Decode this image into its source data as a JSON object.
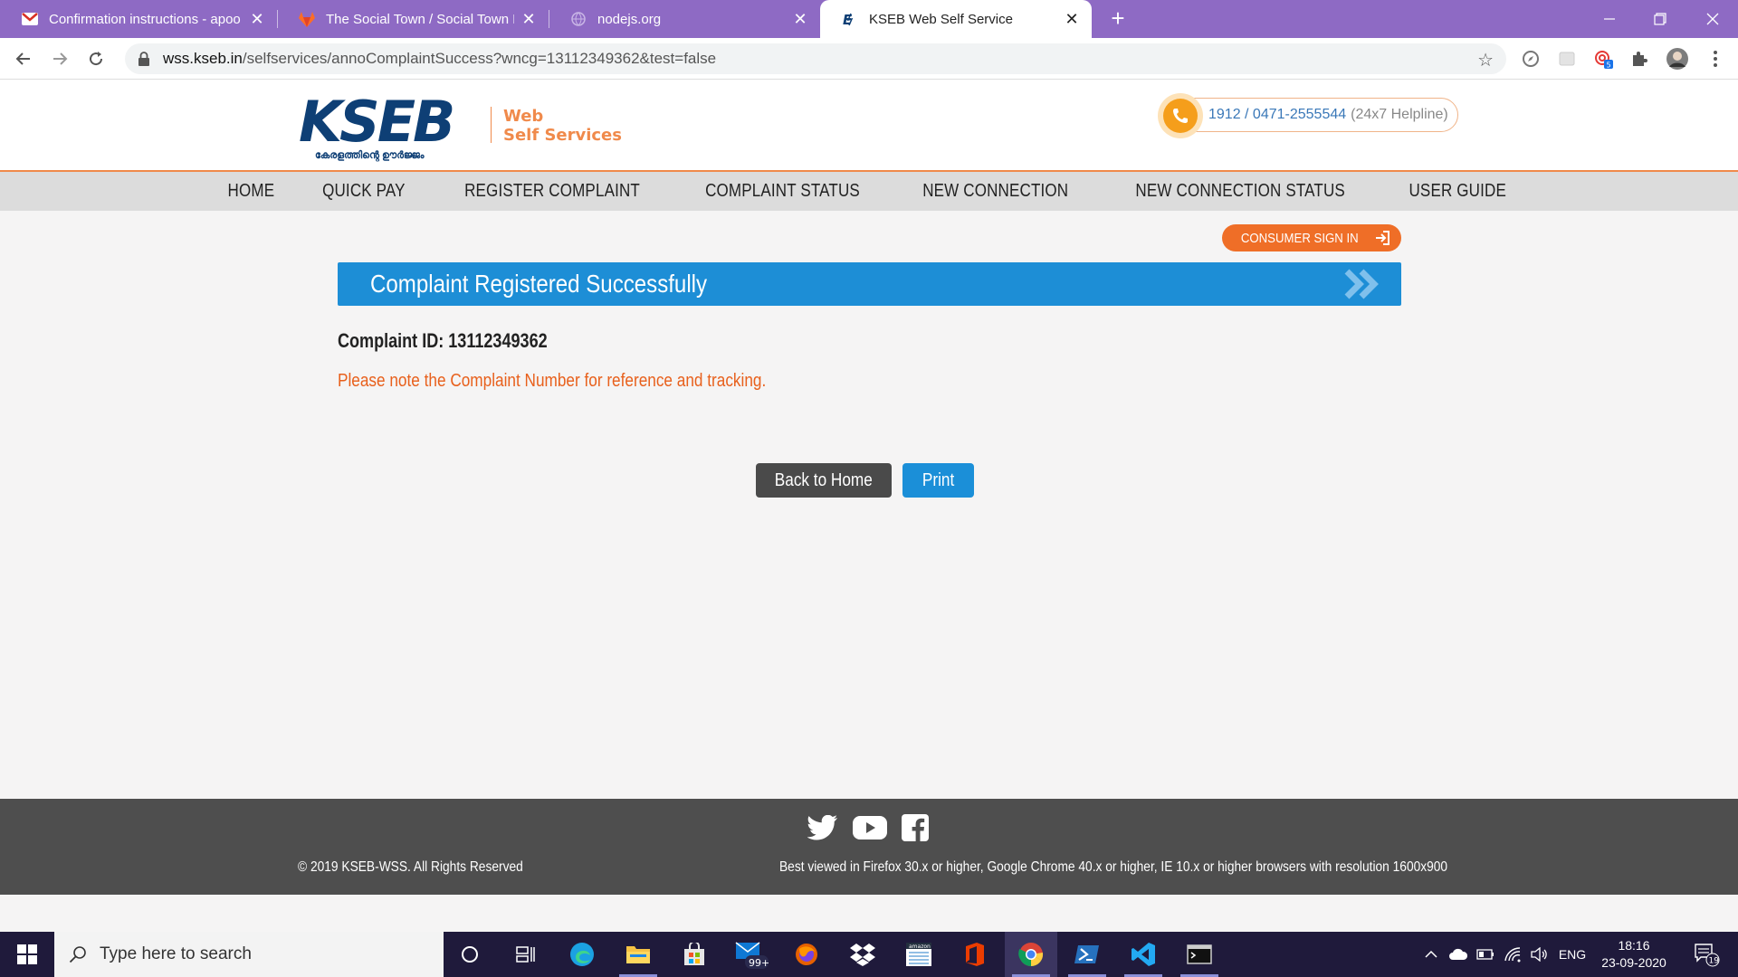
{
  "browser": {
    "tabs": [
      {
        "title": "Confirmation instructions - apoo",
        "icon": "gmail-icon"
      },
      {
        "title": "The Social Town / Social Town Fr",
        "icon": "gitlab-icon"
      },
      {
        "title": "nodejs.org",
        "icon": "globe-icon"
      },
      {
        "title": "KSEB Web Self Service",
        "icon": "kseb-icon"
      }
    ],
    "url_host": "wss.kseb.in",
    "url_path": "/selfservices/annoComplaintSuccess?wncg=13112349362&test=false",
    "extension_badge": "5"
  },
  "site": {
    "logo_text": "KSEB",
    "logo_tagline": "കേരളത്തിന്റെ ഊർജ്ജം",
    "logo_sub_1": "Web",
    "logo_sub_2": "Self Services",
    "helpline_number": "1912 / 0471-2555544",
    "helpline_note": "(24x7 Helpline)",
    "nav": [
      "HOME",
      "QUICK PAY",
      "REGISTER COMPLAINT",
      "COMPLAINT STATUS",
      "NEW CONNECTION",
      "NEW CONNECTION STATUS",
      "USER GUIDE"
    ],
    "signin_label": "CONSUMER SIGN IN",
    "accent_color": "#ef6e27",
    "primary_color": "#1d8ed6"
  },
  "main": {
    "banner_title": "Complaint Registered Successfully",
    "complaint_id_text": "Complaint ID: 13112349362",
    "note": "Please note the Complaint Number for reference and tracking.",
    "back_button": "Back to Home",
    "print_button": "Print"
  },
  "footer": {
    "copyright": "© 2019 KSEB-WSS. All Rights Reserved",
    "best_viewed": "Best viewed in Firefox 30.x or higher, Google Chrome 40.x or higher, IE 10.x or higher browsers with resolution 1600x900",
    "social": [
      "twitter-icon",
      "youtube-icon",
      "facebook-icon"
    ]
  },
  "taskbar": {
    "search_placeholder": "Type here to search",
    "mail_badge": "99+",
    "language": "ENG",
    "time": "18:16",
    "date": "23-09-2020",
    "notification_count": "19"
  }
}
